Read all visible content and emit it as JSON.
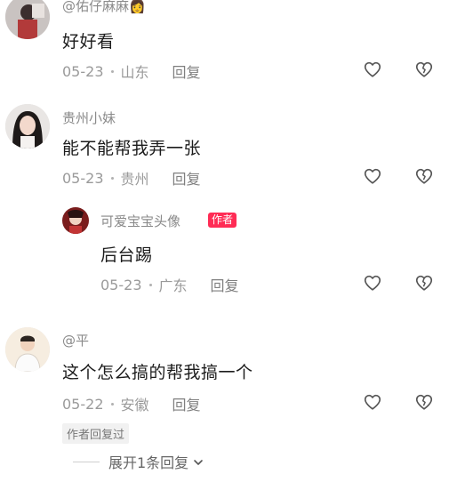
{
  "comments": [
    {
      "username": "@佑仔麻麻👩",
      "text": "好好看",
      "date": "05-23",
      "location": "山东",
      "reply_label": "回复"
    },
    {
      "username": "贵州小妹",
      "text": "能不能帮我弄一张",
      "date": "05-23",
      "location": "贵州",
      "reply_label": "回复"
    },
    {
      "username": "可爱宝宝头像",
      "author_tag": "作者",
      "text": "后台踢",
      "date": "05-23",
      "location": "广东",
      "reply_label": "回复"
    },
    {
      "username": "@平",
      "text": "这个怎么搞的帮我搞一个",
      "date": "05-22",
      "location": "安徽",
      "reply_label": "回复",
      "author_replied": "作者回复过",
      "expand_label": "展开1条回复"
    }
  ],
  "icons": {
    "like": "heart-icon",
    "dislike": "broken-heart-icon",
    "expand": "chevron-down-icon"
  },
  "colors": {
    "author_tag_bg": "#ff2c55",
    "meta_text": "#9a9a9a"
  }
}
